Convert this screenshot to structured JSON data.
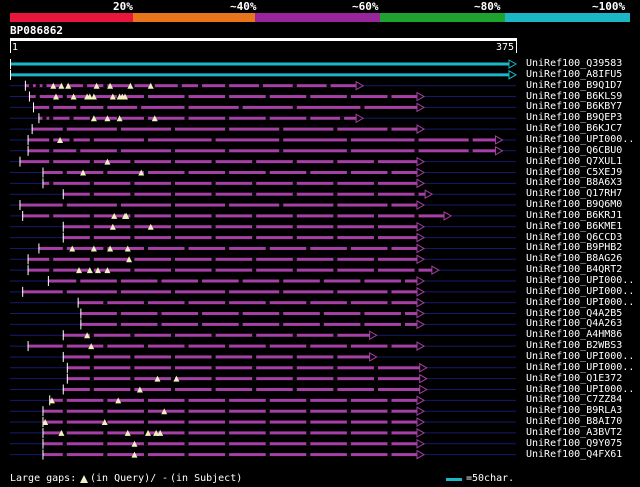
{
  "scale": {
    "labels": [
      "20%",
      "~40%",
      "~60%",
      "~80%",
      "~100%"
    ],
    "colors": [
      "#e8153c",
      "#e8741c",
      "#98259a",
      "#1ea32e",
      "#1bb7c6"
    ]
  },
  "query": {
    "name": "BP086862",
    "length": 375,
    "ruler_start_label": "1",
    "ruler_end_label": "375"
  },
  "colors": {
    "full_hit": "#1bb7c6",
    "hit": "#a640a6",
    "gap_marker": "#f2f0c0",
    "track": "#161a6a"
  },
  "hits": [
    {
      "name": "UniRef100_Q39583",
      "start": 1,
      "end": 375,
      "color": "full",
      "query_gaps": [],
      "subject_gaps": []
    },
    {
      "name": "UniRef100_A8IFU5",
      "start": 1,
      "end": 375,
      "color": "full",
      "query_gaps": [],
      "subject_gaps": []
    },
    {
      "name": "UniRef100_B9Q1D7",
      "start": 12,
      "end": 262,
      "color": "hit",
      "query_gaps": [
        33,
        39,
        44,
        65,
        75,
        90,
        105
      ],
      "subject_gaps": [
        15,
        20,
        25,
        40,
        55,
        70,
        90,
        105,
        125,
        140,
        160,
        185,
        210,
        235
      ]
    },
    {
      "name": "UniRef100_B6KLS9",
      "start": 15,
      "end": 307,
      "color": "hit",
      "query_gaps": [
        35,
        48,
        58,
        60,
        63,
        77,
        82,
        84,
        86
      ],
      "subject_gaps": [
        20,
        40,
        60,
        80,
        100,
        130,
        160,
        190,
        220,
        250,
        280
      ]
    },
    {
      "name": "UniRef100_B6KBY7",
      "start": 18,
      "end": 307,
      "color": "hit",
      "query_gaps": [],
      "subject_gaps": [
        30,
        50,
        70,
        95,
        130,
        170,
        210,
        260
      ]
    },
    {
      "name": "UniRef100_B9QEP3",
      "start": 22,
      "end": 262,
      "color": "hit",
      "query_gaps": [
        63,
        73,
        82,
        108
      ],
      "subject_gaps": [
        25,
        30,
        45,
        60,
        80,
        100,
        130,
        160,
        190,
        220,
        245
      ]
    },
    {
      "name": "UniRef100_B6KJC7",
      "start": 17,
      "end": 307,
      "color": "hit",
      "query_gaps": [],
      "subject_gaps": [
        40,
        80,
        120,
        160,
        200,
        240,
        280
      ]
    },
    {
      "name": "UniRef100_UPI000..",
      "start": 14,
      "end": 365,
      "color": "hit",
      "query_gaps": [
        38
      ],
      "subject_gaps": [
        30,
        45,
        60,
        100,
        150,
        200,
        250,
        300,
        340
      ]
    },
    {
      "name": "UniRef100_Q6CBU0",
      "start": 14,
      "end": 365,
      "color": "hit",
      "query_gaps": [],
      "subject_gaps": [
        30,
        50,
        80,
        120,
        160,
        200,
        250,
        300,
        340
      ]
    },
    {
      "name": "UniRef100_Q7XUL1",
      "start": 8,
      "end": 307,
      "color": "hit",
      "query_gaps": [
        73
      ],
      "subject_gaps": [
        30,
        60,
        90,
        120,
        150,
        180,
        210,
        240,
        270
      ]
    },
    {
      "name": "UniRef100_C5XEJ9",
      "start": 25,
      "end": 307,
      "color": "hit",
      "query_gaps": [
        55,
        98
      ],
      "subject_gaps": [
        40,
        70,
        100,
        130,
        160,
        190,
        220,
        250,
        280
      ]
    },
    {
      "name": "UniRef100_B8A6X3",
      "start": 25,
      "end": 307,
      "color": "hit",
      "query_gaps": [],
      "subject_gaps": [
        30,
        60,
        90,
        120,
        150,
        180,
        210,
        240,
        270
      ]
    },
    {
      "name": "UniRef100_Q17RH7",
      "start": 40,
      "end": 313,
      "color": "hit",
      "query_gaps": [],
      "subject_gaps": [
        60,
        90,
        120,
        150,
        180,
        210,
        240,
        270,
        300
      ]
    },
    {
      "name": "UniRef100_B9Q6M0",
      "start": 8,
      "end": 307,
      "color": "hit",
      "query_gaps": [],
      "subject_gaps": [
        40,
        80,
        120,
        160,
        200,
        240,
        280
      ]
    },
    {
      "name": "UniRef100_B6KRJ1",
      "start": 10,
      "end": 327,
      "color": "hit",
      "query_gaps": [
        78,
        86,
        87
      ],
      "subject_gaps": [
        30,
        60,
        90,
        120,
        150,
        180,
        210,
        240,
        270,
        300
      ]
    },
    {
      "name": "UniRef100_B6KME1",
      "start": 40,
      "end": 307,
      "color": "hit",
      "query_gaps": [
        77,
        105
      ],
      "subject_gaps": [
        60,
        90,
        120,
        150,
        180,
        210,
        240,
        270
      ]
    },
    {
      "name": "UniRef100_Q6CCD3",
      "start": 40,
      "end": 307,
      "color": "hit",
      "query_gaps": [],
      "subject_gaps": [
        60,
        90,
        120,
        150,
        180,
        210,
        240,
        270
      ]
    },
    {
      "name": "UniRef100_B9PHB2",
      "start": 22,
      "end": 307,
      "color": "hit",
      "query_gaps": [
        47,
        63,
        75,
        88
      ],
      "subject_gaps": [
        40,
        70,
        100,
        130,
        160,
        190,
        220,
        250,
        280
      ]
    },
    {
      "name": "UniRef100_B8AG26",
      "start": 14,
      "end": 307,
      "color": "hit",
      "query_gaps": [
        89
      ],
      "subject_gaps": [
        30,
        60,
        90,
        120,
        150,
        180,
        210,
        240,
        270
      ]
    },
    {
      "name": "UniRef100_B4QRT2",
      "start": 14,
      "end": 318,
      "color": "hit",
      "query_gaps": [
        52,
        60,
        66,
        73
      ],
      "subject_gaps": [
        30,
        60,
        90,
        120,
        150,
        180,
        210,
        240,
        270,
        300
      ]
    },
    {
      "name": "UniRef100_UPI000..",
      "start": 29,
      "end": 307,
      "color": "hit",
      "query_gaps": [],
      "subject_gaps": [
        50,
        80,
        110,
        140,
        170,
        200,
        230,
        260,
        290
      ]
    },
    {
      "name": "UniRef100_UPI000..",
      "start": 10,
      "end": 307,
      "color": "hit",
      "query_gaps": [],
      "subject_gaps": [
        40,
        80,
        120,
        160,
        200,
        240,
        280
      ]
    },
    {
      "name": "UniRef100_UPI000..",
      "start": 51,
      "end": 307,
      "color": "hit",
      "query_gaps": [],
      "subject_gaps": [
        70,
        100,
        130,
        160,
        190,
        220,
        250,
        280
      ]
    },
    {
      "name": "UniRef100_Q4A2B5",
      "start": 53,
      "end": 307,
      "color": "hit",
      "query_gaps": [],
      "subject_gaps": [
        80,
        110,
        140,
        170,
        200,
        230,
        260,
        290
      ]
    },
    {
      "name": "UniRef100_Q4A263",
      "start": 53,
      "end": 307,
      "color": "hit",
      "query_gaps": [],
      "subject_gaps": [
        80,
        110,
        140,
        170,
        200,
        230,
        260,
        290
      ]
    },
    {
      "name": "UniRef100_A4HM86",
      "start": 40,
      "end": 272,
      "color": "hit",
      "query_gaps": [
        58
      ],
      "subject_gaps": [
        60,
        90,
        120,
        150,
        180,
        210,
        240
      ]
    },
    {
      "name": "UniRef100_B2WBS3",
      "start": 14,
      "end": 307,
      "color": "hit",
      "query_gaps": [
        61
      ],
      "subject_gaps": [
        40,
        70,
        100,
        130,
        160,
        190,
        220,
        250,
        280
      ]
    },
    {
      "name": "UniRef100_UPI000..",
      "start": 40,
      "end": 272,
      "color": "hit",
      "query_gaps": [],
      "subject_gaps": [
        60,
        90,
        120,
        150,
        180,
        210,
        240
      ]
    },
    {
      "name": "UniRef100_UPI000..",
      "start": 43,
      "end": 309,
      "color": "hit",
      "query_gaps": [],
      "subject_gaps": [
        60,
        90,
        120,
        150,
        180,
        210,
        240,
        270,
        300
      ]
    },
    {
      "name": "UniRef100_Q1E372",
      "start": 43,
      "end": 309,
      "color": "hit",
      "query_gaps": [
        110,
        124
      ],
      "subject_gaps": [
        60,
        90,
        120,
        150,
        180,
        210,
        240,
        270,
        300
      ]
    },
    {
      "name": "UniRef100_UPI000..",
      "start": 40,
      "end": 309,
      "color": "hit",
      "query_gaps": [
        97
      ],
      "subject_gaps": [
        60,
        90,
        120,
        150,
        180,
        210,
        240,
        270,
        300
      ]
    },
    {
      "name": "UniRef100_C7ZZ84",
      "start": 30,
      "end": 307,
      "color": "hit",
      "query_gaps": [
        32,
        81
      ],
      "subject_gaps": [
        40,
        70,
        100,
        130,
        160,
        190,
        220,
        250,
        280
      ]
    },
    {
      "name": "UniRef100_B9RLA3",
      "start": 25,
      "end": 307,
      "color": "hit",
      "query_gaps": [
        115
      ],
      "subject_gaps": [
        40,
        70,
        100,
        130,
        160,
        190,
        220,
        250,
        280
      ]
    },
    {
      "name": "UniRef100_B8AI70",
      "start": 25,
      "end": 307,
      "color": "hit",
      "query_gaps": [
        27,
        71
      ],
      "subject_gaps": [
        40,
        70,
        100,
        130,
        160,
        190,
        220,
        250,
        280
      ]
    },
    {
      "name": "UniRef100_A3BVT2",
      "start": 25,
      "end": 307,
      "color": "hit",
      "query_gaps": [
        39,
        88,
        103,
        109,
        112
      ],
      "subject_gaps": [
        40,
        70,
        100,
        130,
        160,
        190,
        220,
        250,
        280
      ]
    },
    {
      "name": "UniRef100_Q9Y075",
      "start": 25,
      "end": 307,
      "color": "hit",
      "query_gaps": [
        93
      ],
      "subject_gaps": [
        40,
        70,
        100,
        130,
        160,
        190,
        220,
        250,
        280
      ]
    },
    {
      "name": "UniRef100_Q4FX61",
      "start": 25,
      "end": 307,
      "color": "hit",
      "query_gaps": [
        93
      ],
      "subject_gaps": [
        40,
        70,
        100,
        130,
        160,
        190,
        220,
        250,
        280
      ]
    }
  ],
  "legend": {
    "text": "Large gaps:",
    "query_text": "(in Query)/",
    "dash_symbol": "-",
    "subject_text": "(in Subject)",
    "scale_text": "=50char."
  }
}
